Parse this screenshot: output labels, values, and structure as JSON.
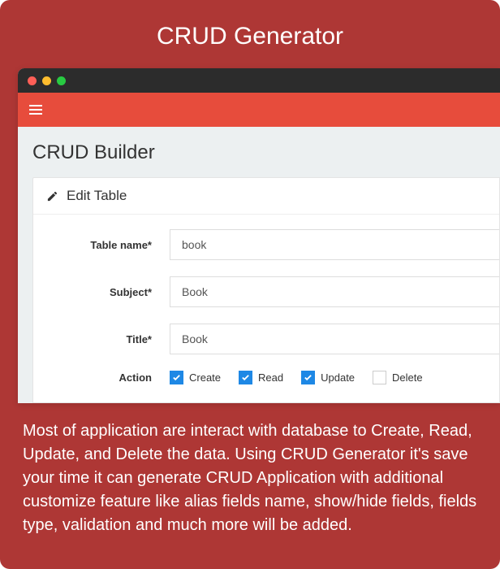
{
  "header": {
    "title": "CRUD Generator"
  },
  "window": {
    "page_title": "CRUD Builder",
    "panel_title": "Edit Table"
  },
  "form": {
    "table_name": {
      "label": "Table name*",
      "value": "book"
    },
    "subject": {
      "label": "Subject*",
      "value": "Book"
    },
    "title": {
      "label": "Title*",
      "value": "Book"
    },
    "action": {
      "label": "Action",
      "options": [
        {
          "label": "Create",
          "checked": true
        },
        {
          "label": "Read",
          "checked": true
        },
        {
          "label": "Update",
          "checked": true
        },
        {
          "label": "Delete",
          "checked": false
        }
      ]
    }
  },
  "description": "Most of application are interact with database to Create, Read, Update, and Delete the data. Using CRUD Generator it's save your time it can generate CRUD Application with additional customize feature like alias fields name, show/hide fields, fields type, validation and much more will be added."
}
